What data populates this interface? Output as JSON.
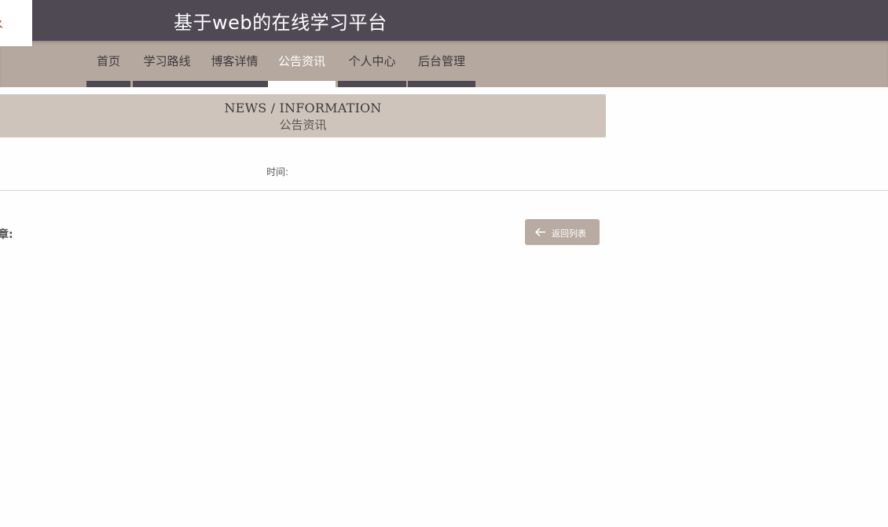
{
  "header": {
    "site_title": "基于web的在线学习平台",
    "logo_icon": "logo-icon"
  },
  "nav": {
    "items": [
      {
        "label": "首页",
        "active": false
      },
      {
        "label": "学习路线",
        "active": false
      },
      {
        "label": "博客详情",
        "active": false
      },
      {
        "label": "公告资讯",
        "active": true
      },
      {
        "label": "个人中心",
        "active": false
      },
      {
        "label": "后台管理",
        "active": false
      }
    ]
  },
  "section": {
    "title_en": "NEWS / INFORMATION",
    "title_cn": "公告资讯"
  },
  "article": {
    "time_label": "时间:",
    "content_label": "章:"
  },
  "actions": {
    "back_label": "返回列表",
    "back_icon": "arrow-left-icon"
  },
  "colors": {
    "header_bg": "#4f4953",
    "nav_bg": "#b5a89f",
    "band_bg": "#cec4bb",
    "button_bg": "#b9aba1"
  }
}
